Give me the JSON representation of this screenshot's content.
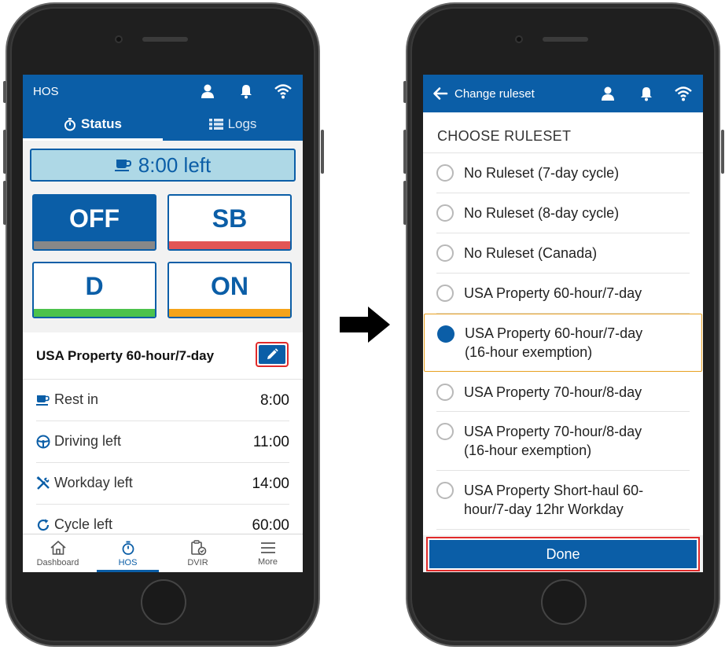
{
  "left_screen": {
    "appbar": {
      "title": "HOS"
    },
    "tabs": {
      "status": "Status",
      "logs": "Logs"
    },
    "time_left": "8:00 left",
    "status_buttons": {
      "off": {
        "label": "OFF",
        "bar_color": "#888888"
      },
      "sb": {
        "label": "SB",
        "bar_color": "#e25555"
      },
      "d": {
        "label": "D",
        "bar_color": "#4cc24c"
      },
      "on": {
        "label": "ON",
        "bar_color": "#f5a31a"
      }
    },
    "ruleset_title": "USA Property 60-hour/7-day",
    "stats": [
      {
        "icon": "coffee-icon",
        "label": "Rest in",
        "value": "8:00"
      },
      {
        "icon": "steering-wheel-icon",
        "label": "Driving left",
        "value": "11:00"
      },
      {
        "icon": "tools-icon",
        "label": "Workday left",
        "value": "14:00"
      },
      {
        "icon": "cycle-icon",
        "label": "Cycle left",
        "value": "60:00"
      }
    ],
    "bottom_nav": [
      {
        "icon": "home-icon",
        "label": "Dashboard"
      },
      {
        "icon": "stopwatch-icon",
        "label": "HOS"
      },
      {
        "icon": "clipboard-check-icon",
        "label": "DVIR"
      },
      {
        "icon": "menu-icon",
        "label": "More"
      }
    ]
  },
  "right_screen": {
    "appbar": {
      "title": "Change ruleset"
    },
    "header": "CHOOSE RULESET",
    "rulesets": [
      {
        "line1": "No Ruleset (7-day cycle)",
        "line2": "",
        "checked": false
      },
      {
        "line1": "No Ruleset (8-day cycle)",
        "line2": "",
        "checked": false
      },
      {
        "line1": "No Ruleset (Canada)",
        "line2": "",
        "checked": false
      },
      {
        "line1": "USA Property 60-hour/7-day",
        "line2": "",
        "checked": false
      },
      {
        "line1": "USA Property 60-hour/7-day",
        "line2": "(16-hour exemption)",
        "checked": true
      },
      {
        "line1": "USA Property 70-hour/8-day",
        "line2": "",
        "checked": false
      },
      {
        "line1": "USA Property 70-hour/8-day",
        "line2": "(16-hour exemption)",
        "checked": false
      },
      {
        "line1": "USA Property Short-haul 60-",
        "line2": "hour/7-day 12hr Workday",
        "checked": false
      }
    ],
    "done_label": "Done"
  },
  "colors": {
    "primary": "#0b5ea7",
    "timebox_bg": "#aed8e6",
    "highlight_red": "#e02a2a",
    "selected_border": "#e8a020"
  }
}
